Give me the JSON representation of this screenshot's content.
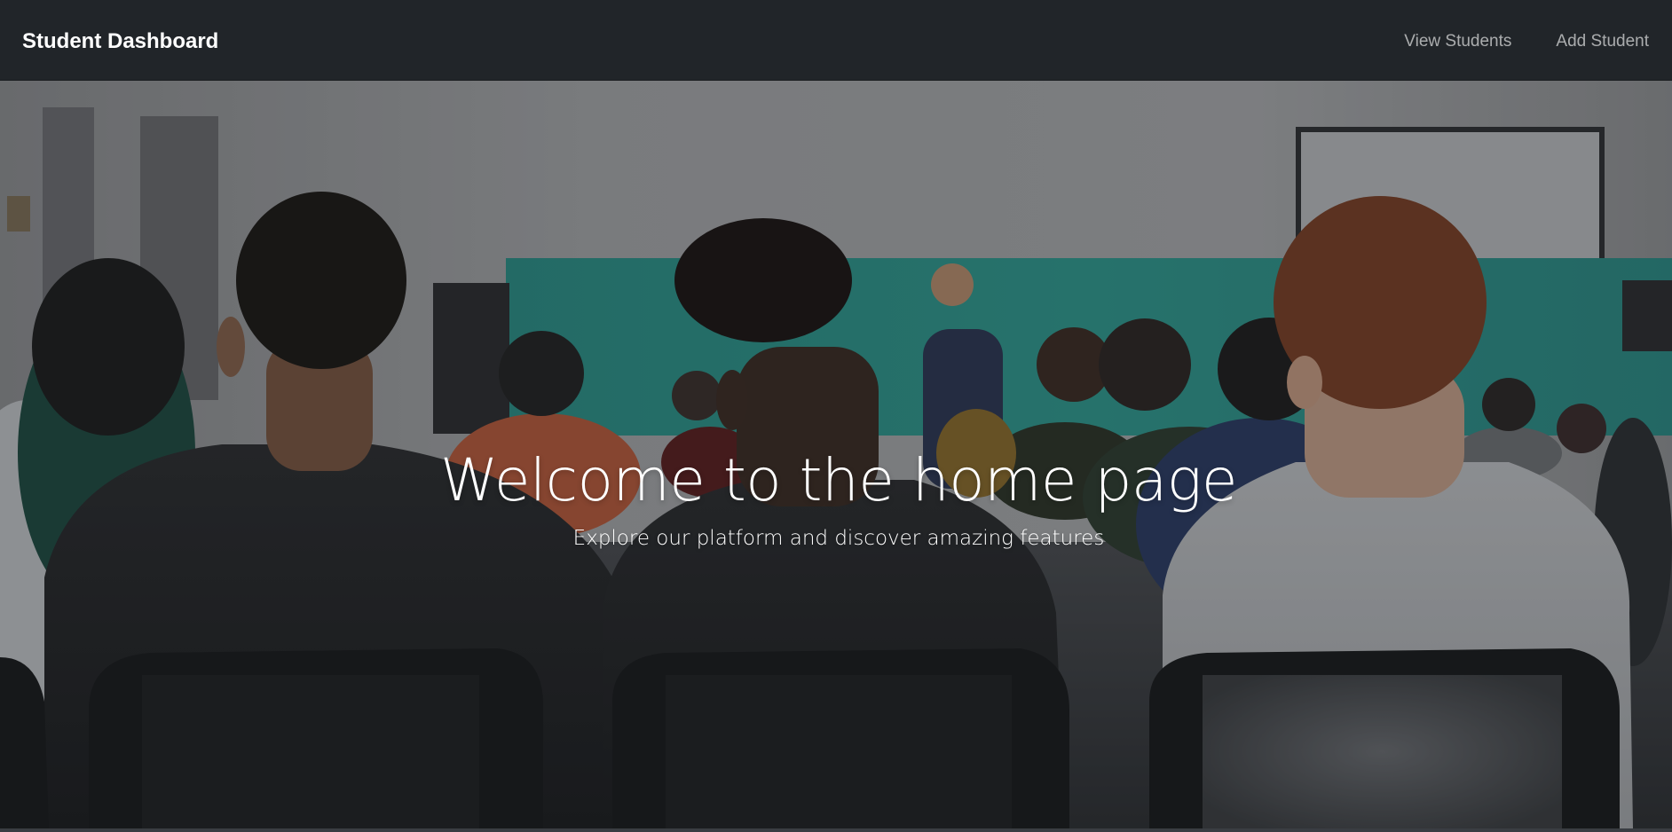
{
  "navbar": {
    "brand": "Student Dashboard",
    "links": [
      {
        "label": "View Students"
      },
      {
        "label": "Add Student"
      }
    ]
  },
  "hero": {
    "title": "Welcome to the home page",
    "subtitle": "Explore our platform and discover amazing features",
    "background_image": "audience-seated-watching-presenter-photo"
  },
  "colors": {
    "navbar_bg": "#212529",
    "brand_text": "#ffffff",
    "nav_link_text": "#a6a8ab",
    "hero_text": "#ffffff",
    "banner_teal": "#2aa89a"
  }
}
